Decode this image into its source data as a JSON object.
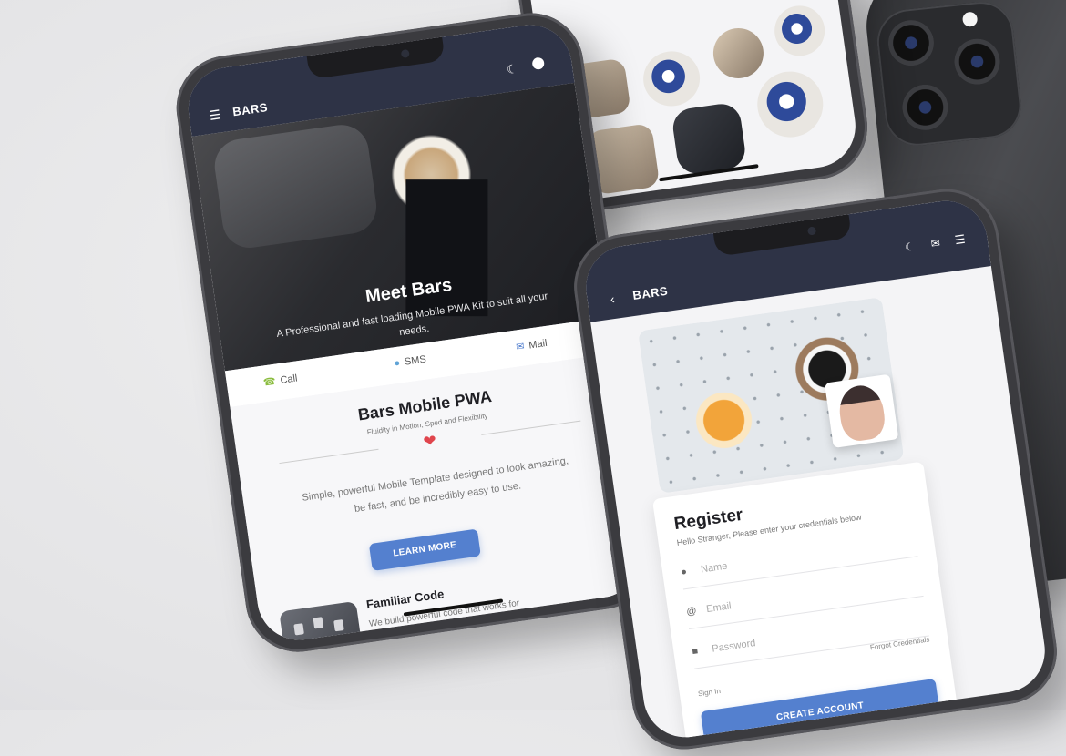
{
  "phone_main": {
    "brand": "BARS",
    "hero": {
      "title": "Meet Bars",
      "subtitle": "A Professional and fast loading Mobile PWA Kit to suit all your needs."
    },
    "contact": {
      "call": "Call",
      "sms": "SMS",
      "mail": "Mail"
    },
    "section": {
      "title": "Bars Mobile PWA",
      "tagline": "Fluidity in Motion, Sped and Flexibility",
      "description": "Simple, powerful Mobile Template designed to look amazing, be fast, and be incredibly easy to use.",
      "button": "LEARN MORE"
    },
    "feature": {
      "title": "Familiar Code",
      "text": "We build powerful code that works for you, smooth, fast and"
    }
  },
  "phone_register": {
    "brand": "BARS",
    "title": "Register",
    "hint": "Hello Stranger, Please enter your credentials below",
    "fields": {
      "name_placeholder": "Name",
      "email_placeholder": "Email",
      "password_placeholder": "Password"
    },
    "forgot": "Forgot Credentials",
    "signin": "Sign In",
    "button": "CREATE ACCOUNT"
  },
  "icons": {
    "menu": "hamburger-icon",
    "moon": "moon-icon",
    "user": "user-icon",
    "mail": "mail-icon",
    "back": "chevron-left-icon",
    "phone": "phone-icon",
    "sms": "chat-bubble-icon",
    "heart": "heart-icon",
    "lock": "lock-icon",
    "at": "at-icon"
  },
  "colors": {
    "header": "#2e3346",
    "accent_blue": "#5480cf",
    "heart_red": "#e0454d",
    "call_green": "#8bbd3f"
  }
}
